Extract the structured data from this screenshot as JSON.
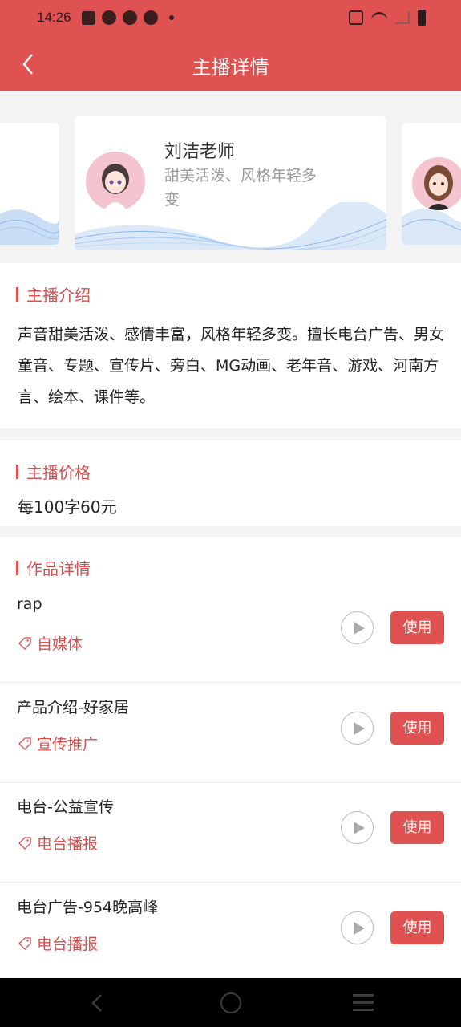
{
  "status_bar": {
    "time": "14:26"
  },
  "header": {
    "title": "主播详情"
  },
  "host": {
    "name": "刘洁老师",
    "tagline": "甜美活泼、风格年轻多变"
  },
  "intro": {
    "title": "主播介绍",
    "text": "声音甜美活泼、感情丰富，风格年轻多变。擅长电台广告、男女童音、专题、宣传片、旁白、MG动画、老年音、游戏、河南方言、绘本、课件等。"
  },
  "price": {
    "title": "主播价格",
    "text": "每100字60元"
  },
  "works": {
    "title": "作品详情",
    "use_label": "使用",
    "items": [
      {
        "title": "rap",
        "tag": "自媒体"
      },
      {
        "title": "产品介绍-好家居",
        "tag": "宣传推广"
      },
      {
        "title": "电台-公益宣传",
        "tag": "电台播报"
      },
      {
        "title": "电台广告-954晚高峰",
        "tag": "电台播报"
      }
    ]
  },
  "colors": {
    "accent": "#e05151",
    "tag": "#d84f4f"
  }
}
